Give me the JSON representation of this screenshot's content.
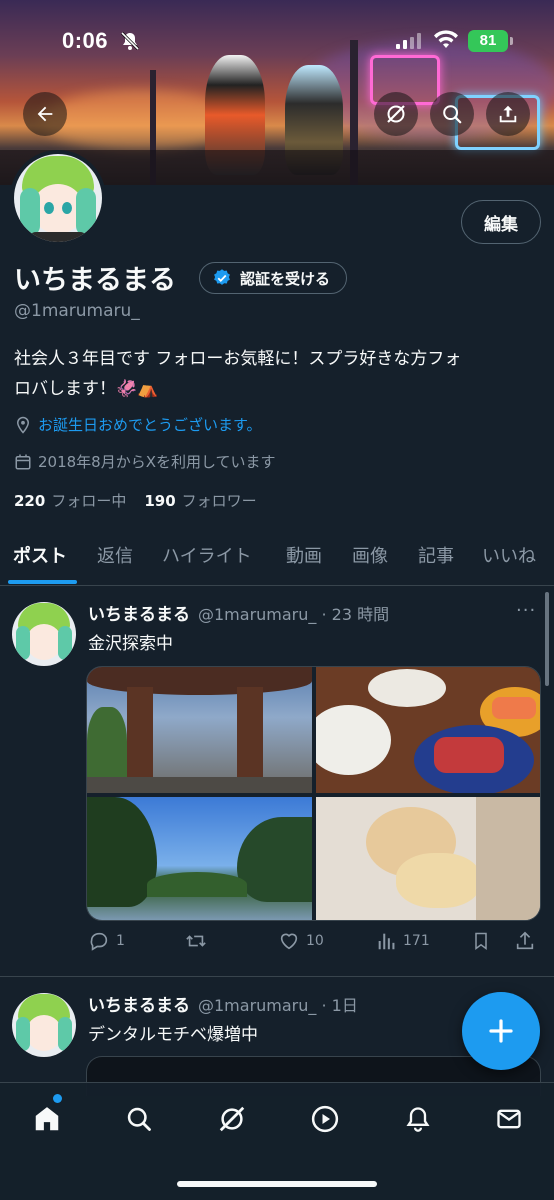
{
  "status_bar": {
    "time": "0:06",
    "battery": "81"
  },
  "banner": {
    "back_icon": "arrow-left-icon",
    "actions": [
      "grok-icon",
      "search-icon",
      "share-icon"
    ]
  },
  "profile": {
    "display_name": "いちまるまる",
    "verify_button": "認証を受ける",
    "handle": "@1marumaru_",
    "edit_button": "編集",
    "bio_line1": "社会人３年目です フォローお気軽に！スプラ好きな方フォ",
    "bio_line2": "ロバします！🦑⛺",
    "location": "お誕生日おめでとうございます。",
    "joined": "2018年8月からXを利用しています",
    "following_count": "220",
    "following_label": "フォロー中",
    "followers_count": "190",
    "followers_label": "フォロワー"
  },
  "tabs": [
    "ポスト",
    "返信",
    "ハイライト",
    "動画",
    "画像",
    "記事",
    "いいね"
  ],
  "tweets": [
    {
      "name": "いちまるまる",
      "handle_time": "@1marumaru_ · 23 時間",
      "text": "金沢探索中",
      "replies": "1",
      "retweets": "",
      "likes": "10",
      "views": "171"
    },
    {
      "name": "いちまるまる",
      "handle_time": "@1marumaru_ · 1日",
      "text": "デンタルモチベ爆増中"
    }
  ],
  "more_icon": "···",
  "colors": {
    "background": "#15202b",
    "accent": "#1d9bf0",
    "secondary_text": "#8b98a5",
    "border": "#38444d"
  },
  "bottom_nav": [
    "home-icon",
    "search-icon",
    "grok-icon",
    "play-icon",
    "notification-bell-icon",
    "mail-icon"
  ]
}
